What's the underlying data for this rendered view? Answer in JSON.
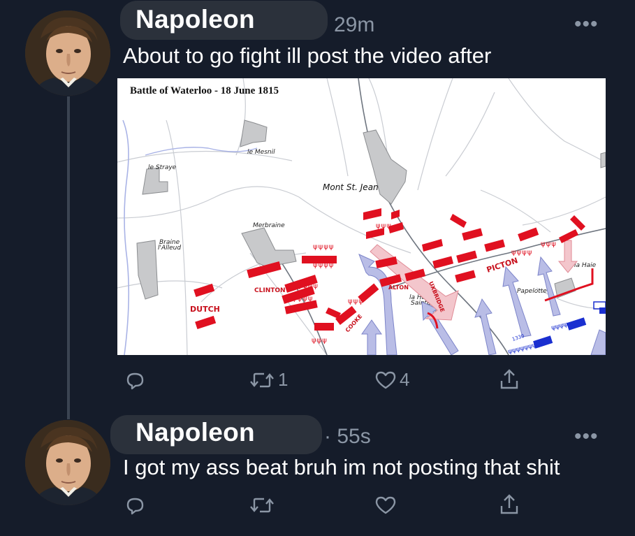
{
  "tweets": [
    {
      "display_name": "Napoleon",
      "time": "29m",
      "more": "•••",
      "text": "About to go fight ill post the video after",
      "media": {
        "title": "Battle of Waterloo - 18 June 1815",
        "labels": {
          "le_mesnil": "le Mesnil",
          "le_straye": "le Straye",
          "mont_st_jean": "Mont St. Jean",
          "merbraine": "Merbraine",
          "braine": "Braine",
          "lalleud": "l'Alleud",
          "clinton": "CLINTON",
          "dutch": "DUTCH",
          "alton": "ALTON",
          "cooke": "COOKE",
          "uxbridge": "UXBRIDGE",
          "picton": "PICTON",
          "la_haye": "la Haye",
          "sainte": "Sainte",
          "papelotte": "Papelotte",
          "la_haie": "la Haie",
          "num_1330": "1330"
        }
      },
      "actions": {
        "reply_count": "",
        "retweet_count": "1",
        "like_count": "4"
      }
    },
    {
      "display_name": "Napoleon",
      "time": "· 55s",
      "more": "•••",
      "text": "I got my ass beat bruh im not posting that shit",
      "actions": {
        "reply_count": "",
        "retweet_count": "",
        "like_count": ""
      }
    }
  ],
  "colors": {
    "background": "#151c2a",
    "muted": "#8b96a5",
    "name_pill": "#2b313b",
    "british_red": "#e01020",
    "french_blue": "#1a2fd0",
    "arrow_lavender": "#b9bde6"
  }
}
